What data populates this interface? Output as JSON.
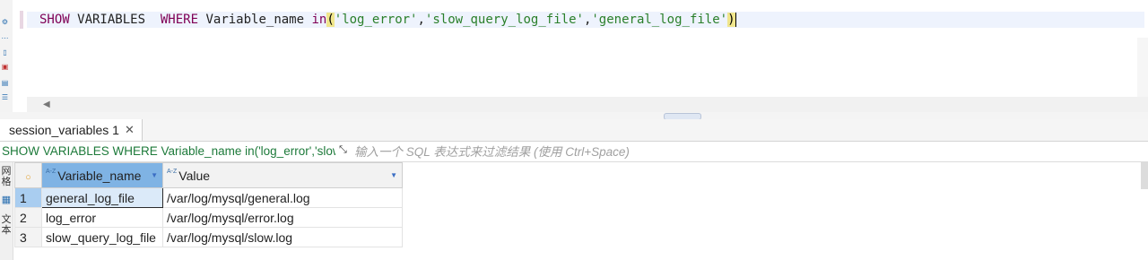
{
  "editor": {
    "sql_keyword_show": "SHOW",
    "sql_plain_variables": " VARIABLES  ",
    "sql_keyword_where": "WHERE",
    "sql_plain_varname": " Variable_name ",
    "sql_keyword_in": "in",
    "sql_paren_open": "(",
    "sql_str_1": "'log_error'",
    "sql_comma_1": ",",
    "sql_str_2": "'slow_query_log_file'",
    "sql_comma_2": ",",
    "sql_str_3": "'general_log_file'",
    "sql_paren_close": ")"
  },
  "results": {
    "tab_label": "session_variables 1",
    "tab_close": "✕",
    "filter_query": "SHOW VARIABLES WHERE Variable_name in('log_error','slow",
    "filter_placeholder": "输入一个 SQL 表达式来过滤结果 (使用 Ctrl+Space)",
    "side_labels": [
      "网格",
      "文本"
    ],
    "columns": [
      {
        "az": "A-Z",
        "label": "Variable_name"
      },
      {
        "az": "A-Z",
        "label": "Value"
      }
    ],
    "rows": [
      {
        "num": "1",
        "name": "general_log_file",
        "value": "/var/log/mysql/general.log"
      },
      {
        "num": "2",
        "name": "log_error",
        "value": "/var/log/mysql/error.log"
      },
      {
        "num": "3",
        "name": "slow_query_log_file",
        "value": "/var/log/mysql/slow.log"
      }
    ],
    "selected_row": 1
  },
  "icons": {
    "tab_icon": "table-icon",
    "filter_icon": "filter-expand-icon"
  },
  "colors": {
    "keyword": "#7f0055",
    "string": "#2a7f2a",
    "filter_query": "#1d7a3a",
    "selected_header": "#7fb3e4"
  }
}
